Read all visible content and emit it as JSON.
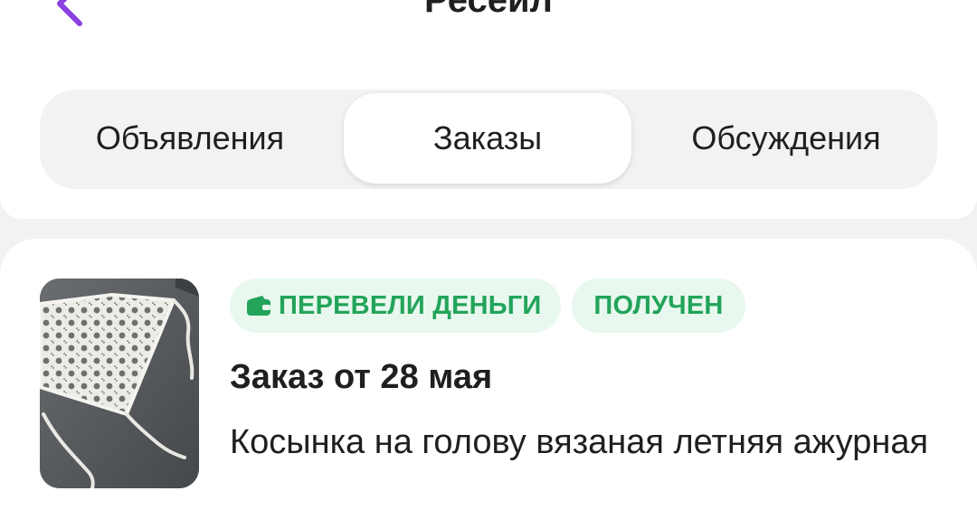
{
  "header": {
    "title": "Ресейл",
    "back_icon": "chevron-left-icon",
    "accent_color": "#8b3fe0"
  },
  "tabs": [
    {
      "label": "Объявления",
      "selected": false
    },
    {
      "label": "Заказы",
      "selected": true
    },
    {
      "label": "Обсуждения",
      "selected": false
    }
  ],
  "order": {
    "badges": [
      {
        "label": "ПЕРЕВЕЛИ ДЕНЬГИ",
        "icon": "wallet-icon"
      },
      {
        "label": "ПОЛУЧЕН"
      }
    ],
    "badge_color": "#22a45a",
    "badge_bg": "#e8f8ee",
    "title": "Заказ от 28 мая",
    "description": "Косынка на голову вязаная летняя ажурная",
    "thumbnail": "crochet-kerchief-photo"
  }
}
